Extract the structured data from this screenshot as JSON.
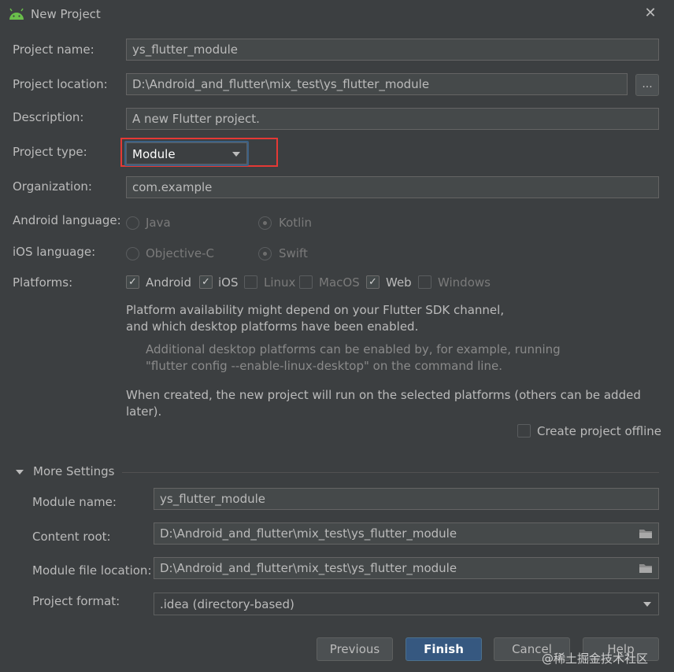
{
  "window": {
    "title": "New Project",
    "close_label": "✕"
  },
  "form": {
    "project_name": {
      "label": "Project name:",
      "value": "ys_flutter_module"
    },
    "project_location": {
      "label": "Project location:",
      "value": "D:\\Android_and_flutter\\mix_test\\ys_flutter_module",
      "browse_label": "..."
    },
    "description": {
      "label": "Description:",
      "value": "A new Flutter project."
    },
    "project_type": {
      "label": "Project type:",
      "value": "Module"
    },
    "organization": {
      "label": "Organization:",
      "value": "com.example"
    },
    "android_language": {
      "label": "Android language:",
      "options": [
        "Java",
        "Kotlin"
      ],
      "selected": "Kotlin"
    },
    "ios_language": {
      "label": "iOS language:",
      "options": [
        "Objective-C",
        "Swift"
      ],
      "selected": "Swift"
    },
    "platforms": {
      "label": "Platforms:",
      "items": [
        {
          "name": "Android",
          "checked": true
        },
        {
          "name": "iOS",
          "checked": true
        },
        {
          "name": "Linux",
          "checked": false
        },
        {
          "name": "MacOS",
          "checked": false
        },
        {
          "name": "Web",
          "checked": true
        },
        {
          "name": "Windows",
          "checked": false
        }
      ]
    },
    "info": {
      "line1": "Platform availability might depend on your Flutter SDK channel,",
      "line2": "and which desktop platforms have been enabled.",
      "hint1": "Additional desktop platforms can be enabled by, for example, running",
      "hint2": "\"flutter config --enable-linux-desktop\" on the command line.",
      "created": "When created, the new project will run on the selected platforms (others can be added later)."
    },
    "offline": {
      "label": "Create project offline",
      "checked": false
    }
  },
  "more_settings": {
    "title": "More Settings",
    "module_name": {
      "label": "Module name:",
      "value": "ys_flutter_module"
    },
    "content_root": {
      "label": "Content root:",
      "value": "D:\\Android_and_flutter\\mix_test\\ys_flutter_module"
    },
    "module_file_location": {
      "label": "Module file location:",
      "value": "D:\\Android_and_flutter\\mix_test\\ys_flutter_module"
    },
    "project_format": {
      "label": "Project format:",
      "value": ".idea (directory-based)"
    }
  },
  "buttons": {
    "previous": "Previous",
    "finish": "Finish",
    "cancel": "Cancel",
    "help": "Help"
  },
  "watermark": "@稀土掘金技术社区",
  "colors": {
    "accent": "#365880",
    "highlight_box": "#e53935",
    "background": "#3c3f41"
  }
}
